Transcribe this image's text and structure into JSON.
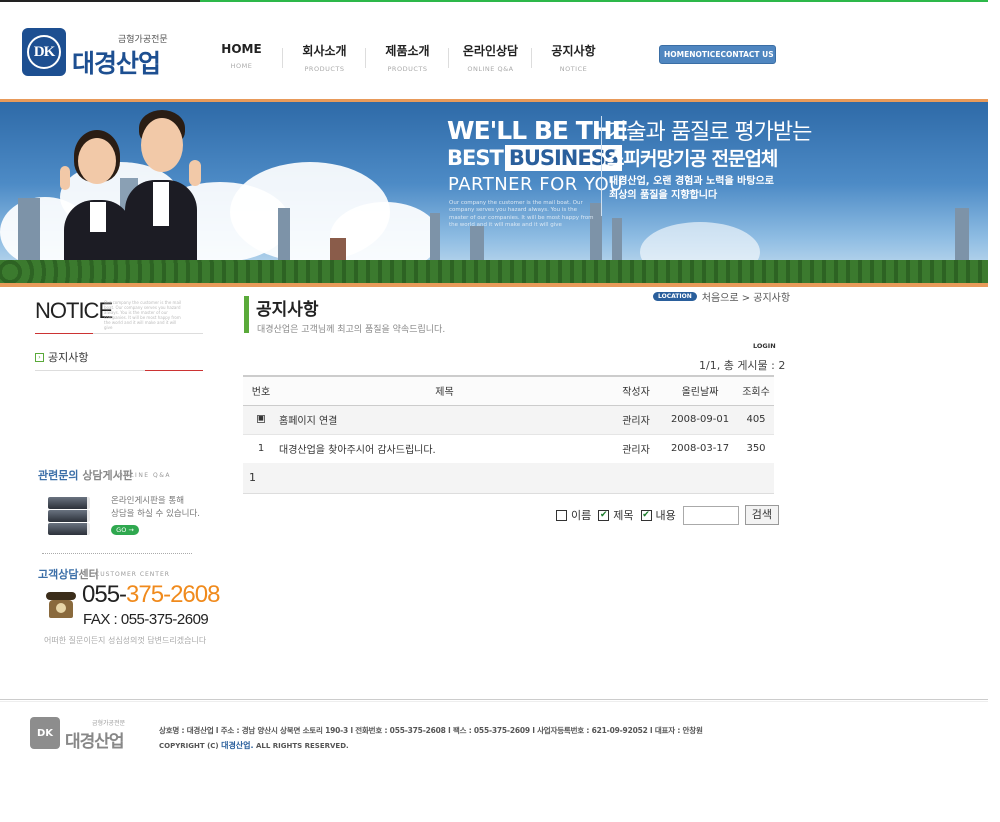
{
  "header": {
    "logo_sub": "금형가공전문",
    "logo_name": "대경산업",
    "logo_mark": "DK",
    "nav": [
      {
        "label": "HOME",
        "sub": "HOME"
      },
      {
        "label": "회사소개",
        "sub": "PRODUCTS"
      },
      {
        "label": "제품소개",
        "sub": "PRODUCTS"
      },
      {
        "label": "온라인상담",
        "sub": "ONLINE Q&A"
      },
      {
        "label": "공지사항",
        "sub": "NOTICE"
      }
    ],
    "toplinks": [
      "HOME",
      "NOTICE",
      "CONTACT US"
    ]
  },
  "banner": {
    "line1": "WE'LL BE THE",
    "line2_a": "BEST",
    "line2_b": "BUSINESS",
    "line3": "PARTNER FOR YOU",
    "small": "Our company the customer is the mail boat. Our company serves you hazard always. You is the master of our companies. It will be most happy from the world and it will make and it will give",
    "kr1": "기술과 품질로 평가받는",
    "kr2": "스피커망기공 전문업체",
    "kr3": "대경산업, 오랜 경험과 노력을 바탕으로 최상의 품질을 지향합니다"
  },
  "sidebar": {
    "title": "NOTICE",
    "mini": "Our company the customer is the mail boat. Our company serves you hazard always. You is the master of our companies. It will be most happy from the world and it will make and it will give",
    "menu_item": "공지사항",
    "qa_title_a": "관련문의",
    "qa_title_b": " 상담게시판",
    "qa_en": "ONLINE Q&A",
    "qa_text1": "온라인게시판을 통해",
    "qa_text2": "상담을 하실 수 있습니다.",
    "qa_go": "GO →",
    "cc_title_a": "고객상담",
    "cc_title_b": "센터",
    "cc_en": "CUSTOMER CENTER",
    "phone_prefix": "055-",
    "phone_rest": "375-2608",
    "fax": "FAX : 055-375-2609",
    "note": "어떠한 질문이든지 성심성의껏 답변드리겠습니다"
  },
  "main": {
    "title": "공지사항",
    "subtitle": "대경산업은 고객님께 최고의 품질을 약속드립니다.",
    "location_badge": "LOCATION",
    "location_text": "처음으로 > 공지사항",
    "login": "LOGIN",
    "count": "1/1, 총 게시물 : 2",
    "columns": [
      "번호",
      "제목",
      "작성자",
      "올린날짜",
      "조회수"
    ],
    "rows": [
      {
        "num": "",
        "title": "홈페이지 연결",
        "author": "관리자",
        "date": "2008-09-01",
        "views": "405"
      },
      {
        "num": "1",
        "title": "대경산업을 찾아주시어 감사드립니다.",
        "author": "관리자",
        "date": "2008-03-17",
        "views": "350"
      }
    ],
    "pager": "1",
    "search": {
      "opt_name": "이름",
      "opt_title": "제목",
      "opt_content": "내용",
      "button": "검색",
      "value": ""
    }
  },
  "footer": {
    "logo_sub": "금형가공전문",
    "logo_name": "대경산업",
    "logo_mark": "DK",
    "info": "상호명 : 대경산업 l 주소 : 경남 양산시 상북면 소토리 190-3 l 전화번호 : 055-375-2608 l 팩스 : 055-375-2609 l 사업자등록번호 : 621-09-92052 l 대표자 : 안창원",
    "copy_a": "COPYRIGHT (C) ",
    "copy_brand": "대경산업.",
    "copy_b": " ALL RIGHTS RESERVED."
  }
}
